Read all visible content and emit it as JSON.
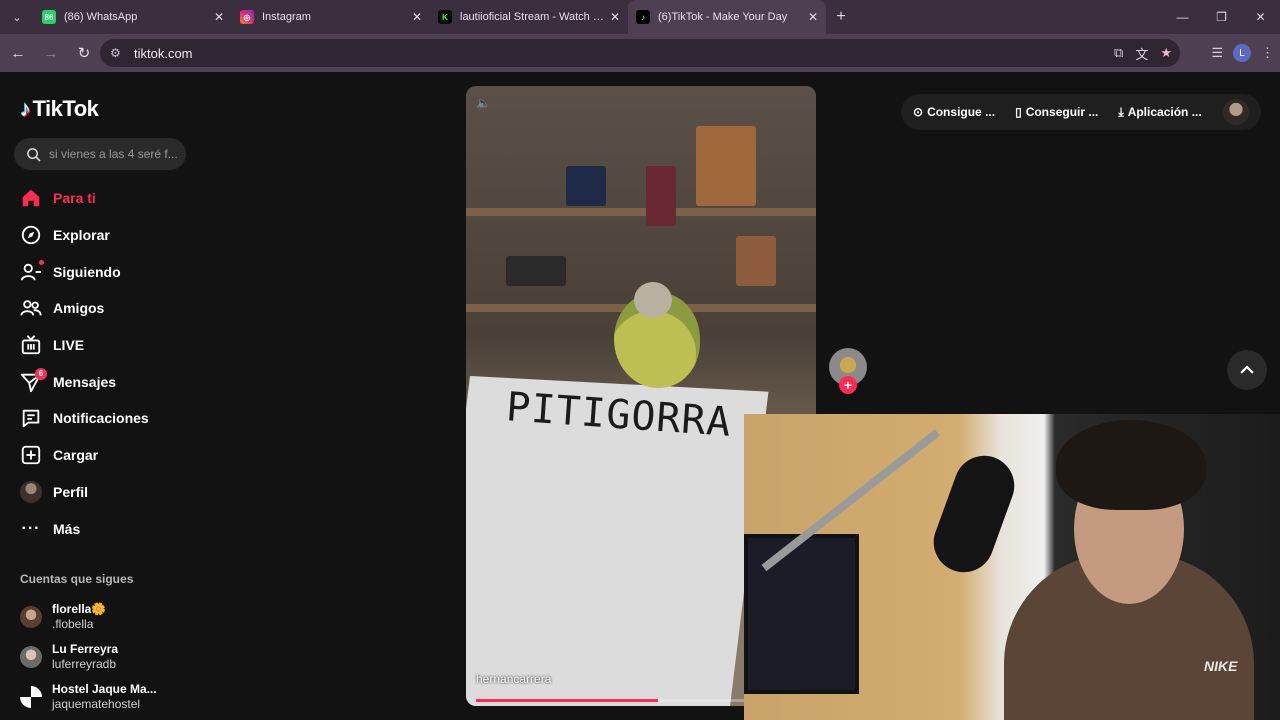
{
  "browser": {
    "tabs": [
      {
        "title": "(86) WhatsApp",
        "favicon": "whatsapp-icon",
        "favicon_badge": "86",
        "color": "#25d366",
        "active": false
      },
      {
        "title": "Instagram",
        "favicon": "instagram-icon",
        "color": "#e1306c",
        "active": false
      },
      {
        "title": "lautiioficial Stream - Watch Live",
        "favicon": "kick-icon",
        "favicon_letter": "K",
        "color": "#53fc18",
        "active": false
      },
      {
        "title": "(6)TikTok - Make Your Day",
        "favicon": "tiktok-icon",
        "color": "#000000",
        "active": true
      }
    ],
    "url": "tiktok.com"
  },
  "sidebar": {
    "logo": "TikTok",
    "search_placeholder": "si vienes a las 4 seré f...",
    "menu": [
      {
        "label": "Para ti",
        "icon": "home-icon",
        "active": true
      },
      {
        "label": "Explorar",
        "icon": "compass-icon"
      },
      {
        "label": "Siguiendo",
        "icon": "following-icon",
        "dot": true
      },
      {
        "label": "Amigos",
        "icon": "friends-icon"
      },
      {
        "label": "LIVE",
        "icon": "live-icon"
      },
      {
        "label": "Mensajes",
        "icon": "messages-icon",
        "badge": "6"
      },
      {
        "label": "Notificaciones",
        "icon": "notifications-icon"
      },
      {
        "label": "Cargar",
        "icon": "upload-icon"
      },
      {
        "label": "Perfil",
        "icon": "profile-avatar"
      },
      {
        "label": "Más",
        "icon": "more-icon"
      }
    ],
    "following_title": "Cuentas que sigues",
    "following": [
      {
        "name": "florella🌼",
        "username": ".flobella"
      },
      {
        "name": "Lu Ferreyra",
        "username": "luferreyradb"
      },
      {
        "name": "Hostel Jaque Ma...",
        "username": "jaquematehostel"
      }
    ]
  },
  "video": {
    "username": "hernancarrera",
    "sign_text": "PITIGORRA",
    "progress": 0.55
  },
  "top_actions": [
    {
      "label": "Consigue ...",
      "icon": "coin-icon"
    },
    {
      "label": "Conseguir ...",
      "icon": "phone-icon"
    },
    {
      "label": "Aplicación ...",
      "icon": "download-icon"
    }
  ],
  "colors": {
    "accent": "#fe2c55",
    "background": "#121212",
    "chrome": "#3b2f3f"
  },
  "webcam": {
    "logo_text": "NIKE"
  }
}
